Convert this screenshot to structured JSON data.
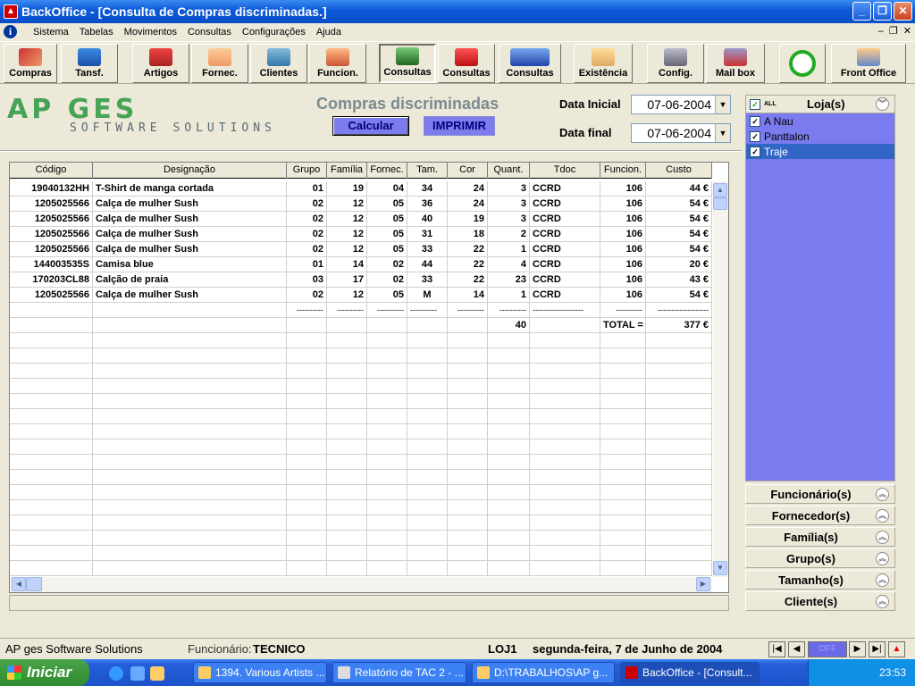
{
  "window": {
    "title": "BackOffice - [Consulta de Compras discriminadas.]"
  },
  "menu": {
    "items": [
      "Sistema",
      "Tabelas",
      "Movimentos",
      "Consultas",
      "Configurações",
      "Ajuda"
    ]
  },
  "toolbar": {
    "compras": "Compras",
    "tansf": "Tansf.",
    "artigos": "Artigos",
    "fornec": "Fornec.",
    "clientes": "Clientes",
    "funcion": "Funcion.",
    "consultas1": "Consultas",
    "consultas2": "Consultas",
    "consultas3": "Consultas",
    "existencia": "Existência",
    "config": "Config.",
    "mailbox": "Mail box",
    "frontoffice": "Front Office"
  },
  "logo": {
    "line1": "AP GES",
    "line2": "SOFTWARE SOLUTIONS"
  },
  "form": {
    "title": "Compras discriminadas",
    "calcular": "Calcular",
    "imprimir": "IMPRIMIR",
    "data_inicial_label": "Data Inicial",
    "data_inicial": "07-06-2004",
    "data_final_label": "Data final",
    "data_final": "07-06-2004"
  },
  "table": {
    "columns": [
      "Código",
      "Designação",
      "Grupo",
      "Família",
      "Fornec.",
      "Tam.",
      "Cor",
      "Quant.",
      "Tdoc",
      "Funcion.",
      "Custo"
    ],
    "rows": [
      [
        "19040132HH",
        "T-Shirt de manga cortada",
        "01",
        "19",
        "04",
        "34",
        "24",
        "3",
        "CCRD",
        "106",
        "44 €"
      ],
      [
        "1205025566",
        "Calça de mulher Sush",
        "02",
        "12",
        "05",
        "36",
        "24",
        "3",
        "CCRD",
        "106",
        "54 €"
      ],
      [
        "1205025566",
        "Calça de mulher Sush",
        "02",
        "12",
        "05",
        "40",
        "19",
        "3",
        "CCRD",
        "106",
        "54 €"
      ],
      [
        "1205025566",
        "Calça de mulher Sush",
        "02",
        "12",
        "05",
        "31",
        "18",
        "2",
        "CCRD",
        "106",
        "54 €"
      ],
      [
        "1205025566",
        "Calça de mulher Sush",
        "02",
        "12",
        "05",
        "33",
        "22",
        "1",
        "CCRD",
        "106",
        "54 €"
      ],
      [
        "144003535S",
        "Camisa blue",
        "01",
        "14",
        "02",
        "44",
        "22",
        "4",
        "CCRD",
        "106",
        "20 €"
      ],
      [
        "170203CL88",
        "Calção de praia",
        "03",
        "17",
        "02",
        "33",
        "22",
        "23",
        "CCRD",
        "106",
        "43 €"
      ],
      [
        "1205025566",
        "Calça de mulher Sush",
        "02",
        "12",
        "05",
        "M",
        "14",
        "1",
        "CCRD",
        "106",
        "54 €"
      ]
    ],
    "dashes": [
      "",
      "",
      "----------",
      "----------",
      "----------",
      "----------",
      "----------",
      "----------",
      "-------------------",
      "----------",
      "-------------------"
    ],
    "total_quant": "40",
    "total_label": "TOTAL =",
    "total_custo": "377 €"
  },
  "lojas": {
    "all_label": "ALL",
    "title": "Loja(s)",
    "items": [
      {
        "label": "A Nau",
        "checked": true
      },
      {
        "label": "Panttalon",
        "checked": true
      },
      {
        "label": "Traje",
        "checked": true
      }
    ]
  },
  "filters": [
    "Funcionário(s)",
    "Fornecedor(s)",
    "Família(s)",
    "Grupo(s)",
    "Tamanho(s)",
    "Cliente(s)"
  ],
  "status": {
    "company": "AP ges Software Solutions",
    "funcionario_label": "Funcionário:",
    "funcionario": "TECNICO",
    "loja": "LOJ1",
    "date": "segunda-feira, 7 de Junho de 2004",
    "off": "OFF"
  },
  "taskbar": {
    "start": "Iniciar",
    "tasks": [
      "1394. Various Artists ...",
      "Relatório de TAC 2 - ...",
      "D:\\TRABALHOS\\AP g...",
      "BackOffice - [Consult..."
    ],
    "clock": "23:53"
  }
}
